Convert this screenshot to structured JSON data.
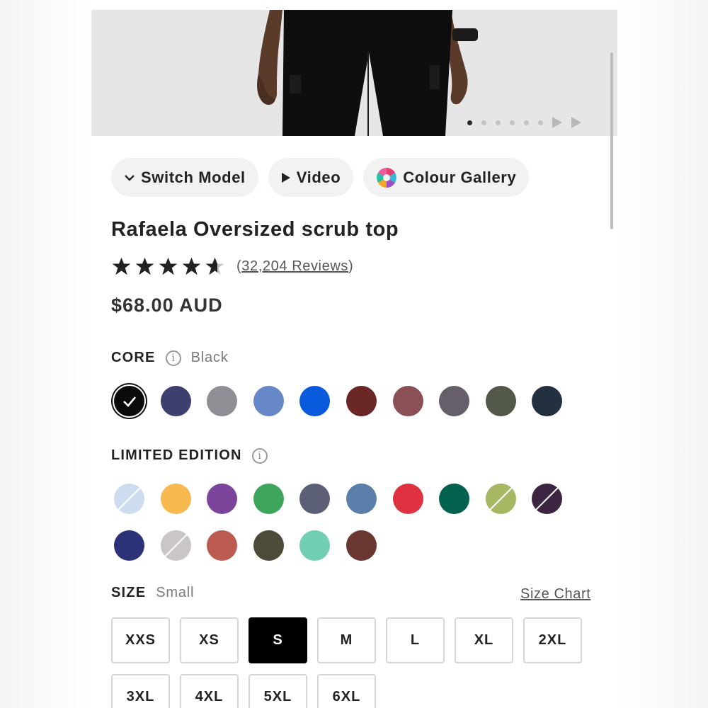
{
  "hero": {
    "image_alt": "",
    "carousel_count": 6,
    "active_index": 0
  },
  "chips": {
    "switch_model": "Switch Model",
    "video": "Video",
    "colour_gallery": "Colour Gallery"
  },
  "product": {
    "title": "Rafaela Oversized scrub top",
    "rating": 4.5,
    "reviews_count_label": "32,204 Reviews",
    "reviews_open": "(",
    "reviews_close": ")",
    "price": "$68.00 AUD"
  },
  "core": {
    "label": "CORE",
    "info": "i",
    "selected_name": "Black",
    "swatches": [
      "#0b0b0b",
      "#3d3f6e",
      "#8d8f95",
      "#6688c9",
      "#0a5ade",
      "#6b2626",
      "#8a5055",
      "#665f69",
      "#52584a",
      "#22303f"
    ],
    "selected_index": 0
  },
  "limited": {
    "label": "LIMITED EDITION",
    "info": "i",
    "swatches": [
      {
        "color": "#cddcee",
        "soldout": true
      },
      {
        "color": "#f7b84f",
        "soldout": false
      },
      {
        "color": "#7c459b",
        "soldout": false
      },
      {
        "color": "#3ea55c",
        "soldout": false
      },
      {
        "color": "#5b6076",
        "soldout": false
      },
      {
        "color": "#5b7fab",
        "soldout": false
      },
      {
        "color": "#df3240",
        "soldout": false
      },
      {
        "color": "#02624e",
        "soldout": false
      },
      {
        "color": "#a6b762",
        "soldout": true
      },
      {
        "color": "#3b2541",
        "soldout": true
      },
      {
        "color": "#2c3278",
        "soldout": false
      },
      {
        "color": "#cac6c6",
        "soldout": true
      },
      {
        "color": "#bc5b4f",
        "soldout": false
      },
      {
        "color": "#4c4a38",
        "soldout": false
      },
      {
        "color": "#72cfb3",
        "soldout": false
      },
      {
        "color": "#6a3631",
        "soldout": false
      }
    ]
  },
  "size": {
    "label": "SIZE",
    "selected_name": "Small",
    "chart_link": "Size Chart",
    "options": [
      "XXS",
      "XS",
      "S",
      "M",
      "L",
      "XL",
      "2XL",
      "3XL",
      "4XL",
      "5XL",
      "6XL"
    ],
    "selected_index": 2
  }
}
